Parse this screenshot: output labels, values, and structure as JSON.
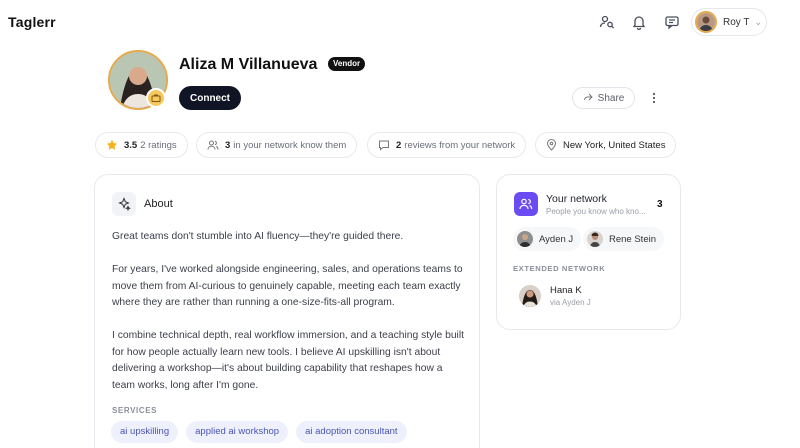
{
  "app": {
    "logo": "Taglerr"
  },
  "topbar": {
    "icons": [
      "people-search-icon",
      "bell-icon",
      "chat-icon"
    ],
    "user": {
      "name": "Roy T"
    }
  },
  "profile": {
    "name": "Aliza M Villanueva",
    "role_badge": "Vendor",
    "connect_label": "Connect",
    "share_label": "Share"
  },
  "stats": {
    "rating_value": "3.5",
    "rating_text": "2 ratings",
    "network_count": "3",
    "network_text": "in your network know them",
    "reviews_count": "2",
    "reviews_text": "reviews from your network",
    "location": "New York, United States"
  },
  "about": {
    "title": "About",
    "paragraphs": [
      "Great teams don't stumble into AI fluency—they're guided there.",
      "For years, I've worked alongside engineering, sales, and operations teams to move them from AI-curious to genuinely capable, meeting each team exactly where they are rather than running a one-size-fits-all program.",
      "I combine technical depth, real workflow immersion, and a teaching style built for how people actually learn new tools. I believe AI upskilling isn't about delivering a workshop—it's about building capability that reshapes how a team works, long after I'm gone."
    ],
    "services_label": "SERVICES",
    "services": [
      "ai upskilling",
      "applied ai workshop",
      "ai adoption consultant"
    ]
  },
  "network": {
    "title": "Your network",
    "subtitle": "People you know who kno...",
    "count": "3",
    "people": [
      "Ayden J",
      "Rene Stein"
    ],
    "extended_label": "EXTENDED NETWORK",
    "extended": [
      {
        "name": "Hana K",
        "via": "via Ayden J"
      }
    ]
  },
  "colors": {
    "accent_purple": "#6b4cf2",
    "connect_bg": "#0f1525",
    "avatar_ring": "#e6a94b",
    "tag_bg": "#eef0fb",
    "tag_text": "#4a55b5"
  }
}
